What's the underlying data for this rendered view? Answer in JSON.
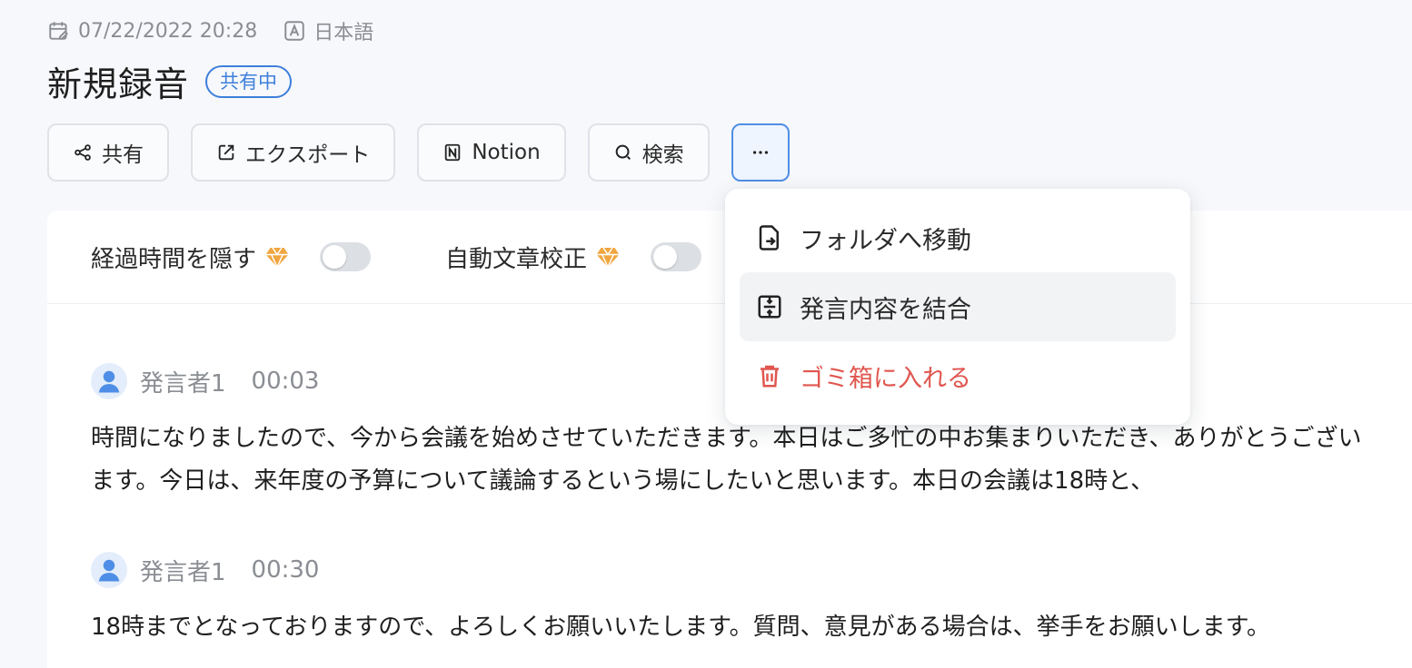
{
  "meta": {
    "datetime": "07/22/2022 20:28",
    "language": "日本語",
    "calendar_icon": "calendar-edit-icon",
    "language_icon": "language-a-icon"
  },
  "header": {
    "title": "新規録音",
    "shared_badge": "共有中"
  },
  "toolbar": {
    "share_label": "共有",
    "export_label": "エクスポート",
    "notion_label": "Notion",
    "search_label": "検索",
    "more_label": "···"
  },
  "settings": {
    "hide_elapsed_label": "経過時間を隠す",
    "auto_correct_label": "自動文章校正",
    "hide_elapsed_on": false,
    "auto_correct_on": false
  },
  "transcript": [
    {
      "speaker": "発言者1",
      "time": "00:03",
      "text": "時間になりましたので、今から会議を始めさせていただきます。本日はご多忙の中お集まりいただき、ありがとうございます。今日は、来年度の予算について議論するという場にしたいと思います。本日の会議は18時と、"
    },
    {
      "speaker": "発言者1",
      "time": "00:30",
      "text": "18時までとなっておりますので、よろしくお願いいたします。質問、意見がある場合は、挙手をお願いします。"
    }
  ],
  "dropdown": {
    "items": [
      {
        "label": "フォルダへ移動",
        "icon": "move-to-folder-icon"
      },
      {
        "label": "発言内容を結合",
        "icon": "merge-icon"
      },
      {
        "label": "ゴミ箱に入れる",
        "icon": "trash-icon"
      }
    ]
  },
  "colors": {
    "accent": "#3d7fdc",
    "danger": "#e0564f",
    "premium": "#f0a640"
  }
}
